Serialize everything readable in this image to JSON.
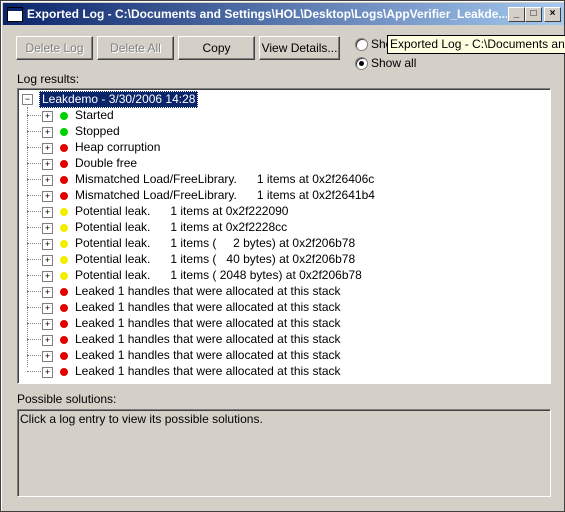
{
  "window": {
    "title": "Exported Log - C:\\Documents and Settings\\HOL\\Desktop\\Logs\\AppVerifier_Leakde...",
    "minimize_glyph": "_",
    "maximize_glyph": "□",
    "close_glyph": "×"
  },
  "toolbar": {
    "delete_log": "Delete Log",
    "delete_all": "Delete All",
    "copy": "Copy",
    "view_details": "View Details..."
  },
  "filter": {
    "option_1": "Show",
    "option_2": "Show all",
    "selected": "Show all"
  },
  "tooltip": "Exported Log - C:\\Documents and Se",
  "log_results": {
    "label": "Log results:",
    "root": "Leakdemo - 3/30/2006 14:28",
    "items": [
      {
        "label": "Started",
        "status": "green"
      },
      {
        "label": "Stopped",
        "status": "green"
      },
      {
        "label": "Heap corruption",
        "status": "red"
      },
      {
        "label": "Double free",
        "status": "red"
      },
      {
        "label": "Mismatched Load/FreeLibrary.      1 items at 0x2f26406c",
        "status": "red"
      },
      {
        "label": "Mismatched Load/FreeLibrary.      1 items at 0x2f2641b4",
        "status": "red"
      },
      {
        "label": "Potential leak.      1 items at 0x2f222090",
        "status": "yellow"
      },
      {
        "label": "Potential leak.      1 items at 0x2f2228cc",
        "status": "yellow"
      },
      {
        "label": "Potential leak.      1 items (     2 bytes) at 0x2f206b78",
        "status": "yellow"
      },
      {
        "label": "Potential leak.      1 items (   40 bytes) at 0x2f206b78",
        "status": "yellow"
      },
      {
        "label": "Potential leak.      1 items ( 2048 bytes) at 0x2f206b78",
        "status": "yellow"
      },
      {
        "label": "Leaked 1 handles that were allocated at this stack",
        "status": "red"
      },
      {
        "label": "Leaked 1 handles that were allocated at this stack",
        "status": "red"
      },
      {
        "label": "Leaked 1 handles that were allocated at this stack",
        "status": "red"
      },
      {
        "label": "Leaked 1 handles that were allocated at this stack",
        "status": "red"
      },
      {
        "label": "Leaked 1 handles that were allocated at this stack",
        "status": "red"
      },
      {
        "label": "Leaked 1 handles that were allocated at this stack",
        "status": "red"
      }
    ]
  },
  "possible_solutions": {
    "label": "Possible solutions:",
    "text": "Click a log entry to view its possible solutions."
  },
  "colors": {
    "green": "#00d000",
    "red": "#e00000",
    "yellow": "#f0f000",
    "selection": "#0a246a"
  }
}
